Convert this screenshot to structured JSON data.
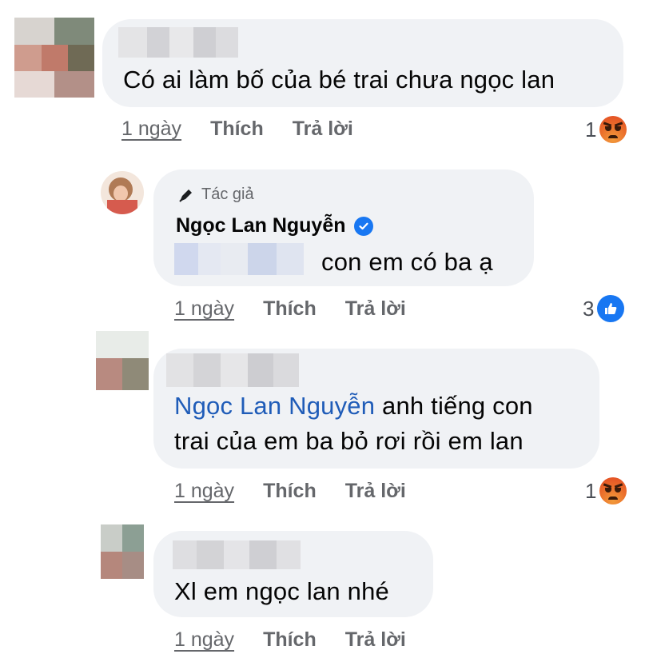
{
  "comments": [
    {
      "text": "Có ai làm bố của bé trai chưa ngọc lan",
      "time": "1 ngày",
      "like_label": "Thích",
      "reply_label": "Trả lời",
      "reaction_count": "1",
      "reaction_icon": "angry-reaction-icon"
    },
    {
      "author_tag": "Tác giả",
      "author_name": "Ngọc Lan Nguyễn",
      "text": "con em có ba ạ",
      "time": "1 ngày",
      "like_label": "Thích",
      "reply_label": "Trả lời",
      "reaction_count": "3",
      "reaction_icon": "like-reaction-icon"
    },
    {
      "mention": "Ngọc Lan Nguyễn",
      "text_line1": "anh tiếng con",
      "text_line2": "trai của em ba bỏ rơi rồi em lan",
      "time": "1 ngày",
      "like_label": "Thích",
      "reply_label": "Trả lời",
      "reaction_count": "1",
      "reaction_icon": "angry-reaction-icon"
    },
    {
      "text": "Xl em ngọc lan nhé",
      "time": "1 ngày",
      "like_label": "Thích",
      "reply_label": "Trả lời"
    }
  ],
  "colors": {
    "bubble": "#f0f2f5",
    "mention": "#1f5cb8",
    "meta": "#65676b",
    "like_blue": "#1877f2"
  }
}
